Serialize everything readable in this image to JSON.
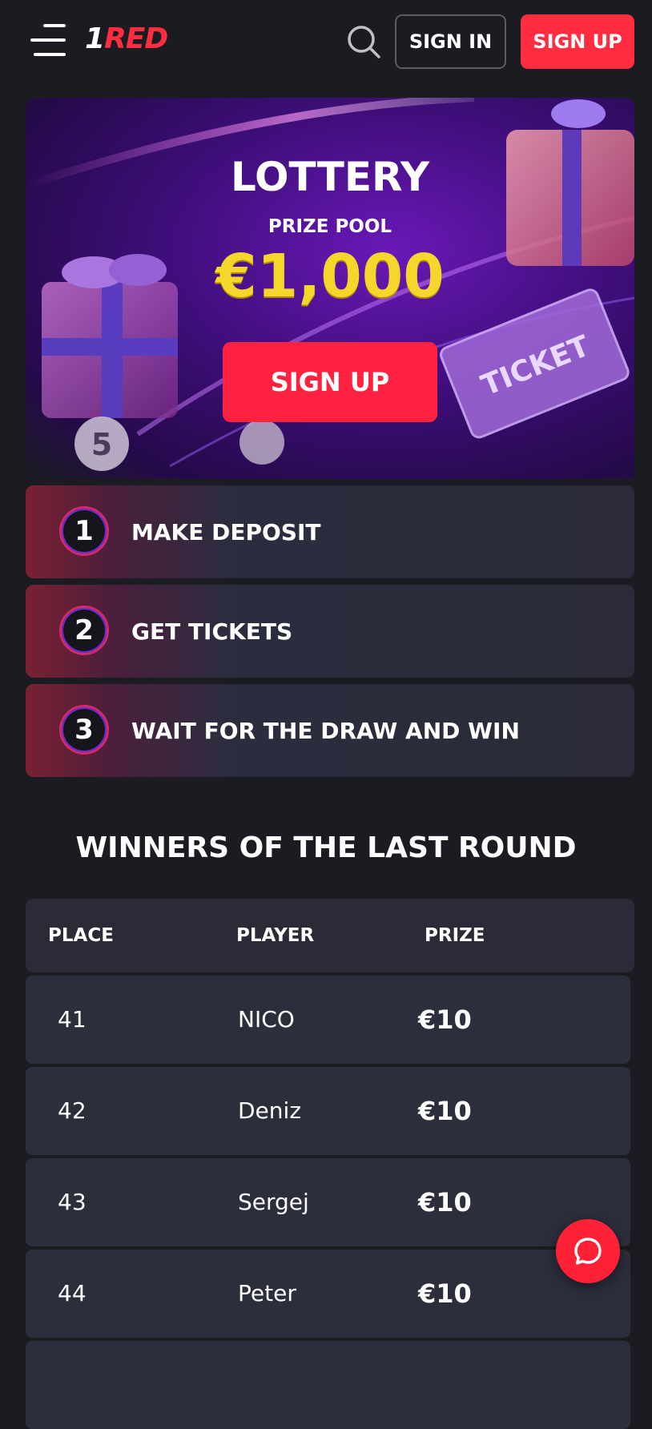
{
  "header": {
    "logo_prefix": "1",
    "logo_text": "RED",
    "sign_in_label": "SIGN IN",
    "sign_up_label": "SIGN UP"
  },
  "banner": {
    "title": "LOTTERY",
    "subtitle": "PRIZE POOL",
    "amount": "€1,000",
    "cta_label": "SIGN UP"
  },
  "steps": [
    {
      "number": "1",
      "label": "MAKE DEPOSIT"
    },
    {
      "number": "2",
      "label": "GET TICKETS"
    },
    {
      "number": "3",
      "label": "WAIT FOR THE DRAW AND WIN"
    }
  ],
  "winners": {
    "title": "WINNERS OF THE LAST ROUND",
    "columns": [
      "PLACE",
      "PLAYER",
      "PRIZE"
    ],
    "rows": [
      {
        "place": "41",
        "player": "NICO",
        "prize": "€10"
      },
      {
        "place": "42",
        "player": "Deniz",
        "prize": "€10"
      },
      {
        "place": "43",
        "player": "Sergej",
        "prize": "€10"
      },
      {
        "place": "44",
        "player": "Peter",
        "prize": "€10"
      },
      {
        "place": "",
        "player": "",
        "prize": ""
      }
    ]
  },
  "icons": {
    "menu": "hamburger-menu-icon",
    "search": "search-icon",
    "chat": "chat-bubble-icon"
  },
  "colors": {
    "accent": "#ff2d3f",
    "prize_gold": "#f5d62a",
    "background": "#1b1c21",
    "card": "#2a2b36"
  }
}
